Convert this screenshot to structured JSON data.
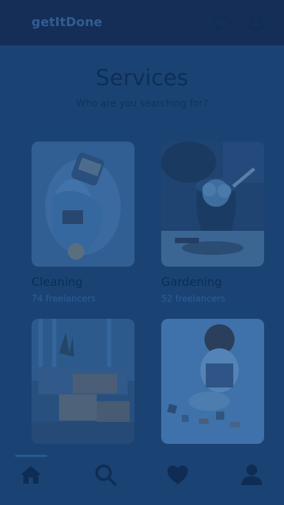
{
  "header": {
    "brand": "getItDone",
    "icons": [
      "chat-icon",
      "bell-icon"
    ]
  },
  "page": {
    "title": "Services",
    "subtitle": "Who are you searching for?"
  },
  "services": [
    {
      "name": "Cleaning",
      "count": "74 freelancers"
    },
    {
      "name": "Gardening",
      "count": "52 freelancers"
    },
    {
      "name": "",
      "count": ""
    },
    {
      "name": "",
      "count": ""
    }
  ],
  "nav": {
    "items": [
      "home-icon",
      "search-icon",
      "heart-icon",
      "profile-icon"
    ],
    "active": "home"
  },
  "colors": {
    "overlay_bg": "#1a4374",
    "header_bg": "#142e57",
    "title": "#0f2e56",
    "accent": "#2a5d99"
  }
}
